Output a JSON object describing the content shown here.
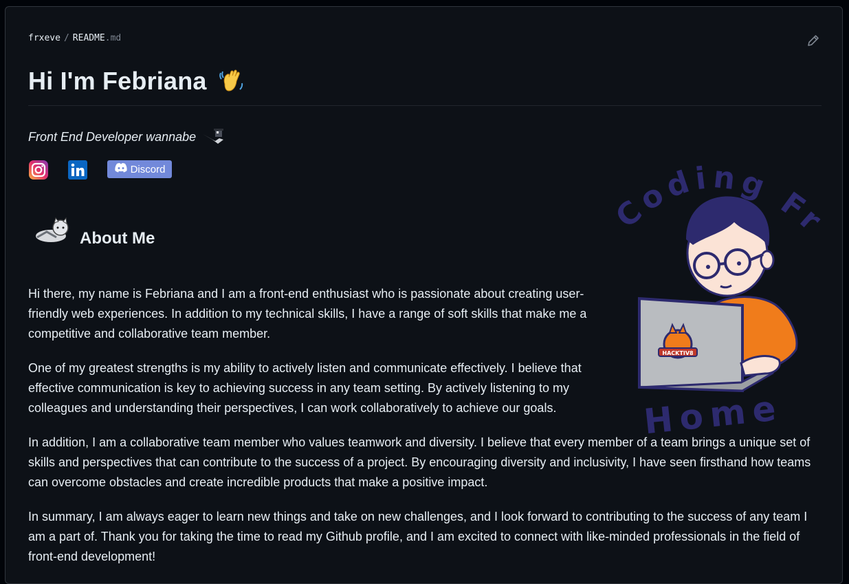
{
  "breadcrumb": {
    "owner": "frxeve",
    "separator": "/",
    "file_name": "README",
    "file_ext": ".md"
  },
  "heading": {
    "title": "Hi I'm Febriana"
  },
  "subtitle": "Front End Developer wannabe",
  "social": {
    "discord_label": "Discord"
  },
  "about": {
    "title": "About Me"
  },
  "paragraphs": [
    "Hi there, my name is Febriana and I am a front-end enthusiast who is passionate about creating user-friendly web experiences. In addition to my technical skills, I have a range of soft skills that make me a competitive and collaborative team member.",
    "One of my greatest strengths is my ability to actively listen and communicate effectively. I believe that effective communication is key to achieving success in any team setting. By actively listening to my colleagues and understanding their perspectives, I can work collaboratively to achieve our goals.",
    "In addition, I am a collaborative team member who values teamwork and diversity. I believe that every member of a team brings a unique set of skills and perspectives that can contribute to the success of a project. By encouraging diversity and inclusivity, I have seen firsthand how teams can overcome obstacles and create incredible products that make a positive impact.",
    "In summary, I am always eager to learn new things and take on new challenges, and I look forward to contributing to the success of any team I am a part of. Thank you for taking the time to read my Github profile, and I am excited to connect with like-minded professionals in the field of front-end development!"
  ],
  "illustration": {
    "top_text": "Coding From",
    "bottom_text": "Home",
    "laptop_sticker": "HACKTIV8"
  },
  "colors": {
    "background": "#0d1117",
    "text": "#e6edf3",
    "muted": "#7d8590",
    "discord": "#7289da",
    "shirt": "#f07c1b",
    "hair": "#2d2a6e"
  }
}
